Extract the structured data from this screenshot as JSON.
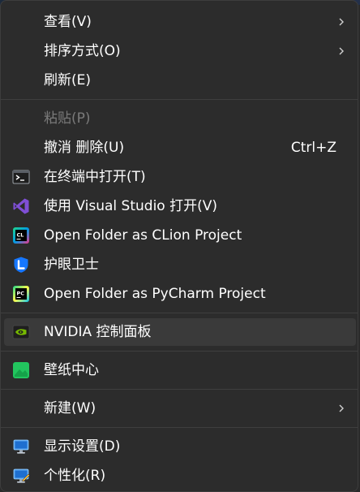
{
  "menu": {
    "items": [
      {
        "label": "查看(V)",
        "has_submenu": true
      },
      {
        "label": "排序方式(O)",
        "has_submenu": true
      },
      {
        "label": "刷新(E)"
      },
      {
        "label": "粘贴(P)",
        "disabled": true
      },
      {
        "label": "撤消 删除(U)",
        "shortcut": "Ctrl+Z"
      },
      {
        "label": "在终端中打开(T)",
        "icon": "terminal-icon"
      },
      {
        "label": "使用 Visual Studio 打开(V)",
        "icon": "visual-studio-icon"
      },
      {
        "label": "Open Folder as CLion Project",
        "icon": "clion-icon"
      },
      {
        "label": "护眼卫士",
        "icon": "eye-shield-icon"
      },
      {
        "label": "Open Folder as PyCharm Project",
        "icon": "pycharm-icon"
      },
      {
        "label": "NVIDIA 控制面板",
        "icon": "nvidia-icon",
        "hovered": true
      },
      {
        "label": "壁纸中心",
        "icon": "wallpaper-icon"
      },
      {
        "label": "新建(W)",
        "has_submenu": true
      },
      {
        "label": "显示设置(D)",
        "icon": "display-settings-icon"
      },
      {
        "label": "个性化(R)",
        "icon": "personalize-icon"
      }
    ]
  },
  "colors": {
    "menu_bg": "#2c2c2c",
    "hover_bg": "#3a3a3a",
    "text": "#ffffff",
    "disabled_text": "#7a7a7a",
    "separator": "#3f3f3f",
    "nvidia_green": "#76b900",
    "wallpaper_green": "#22c55e"
  }
}
